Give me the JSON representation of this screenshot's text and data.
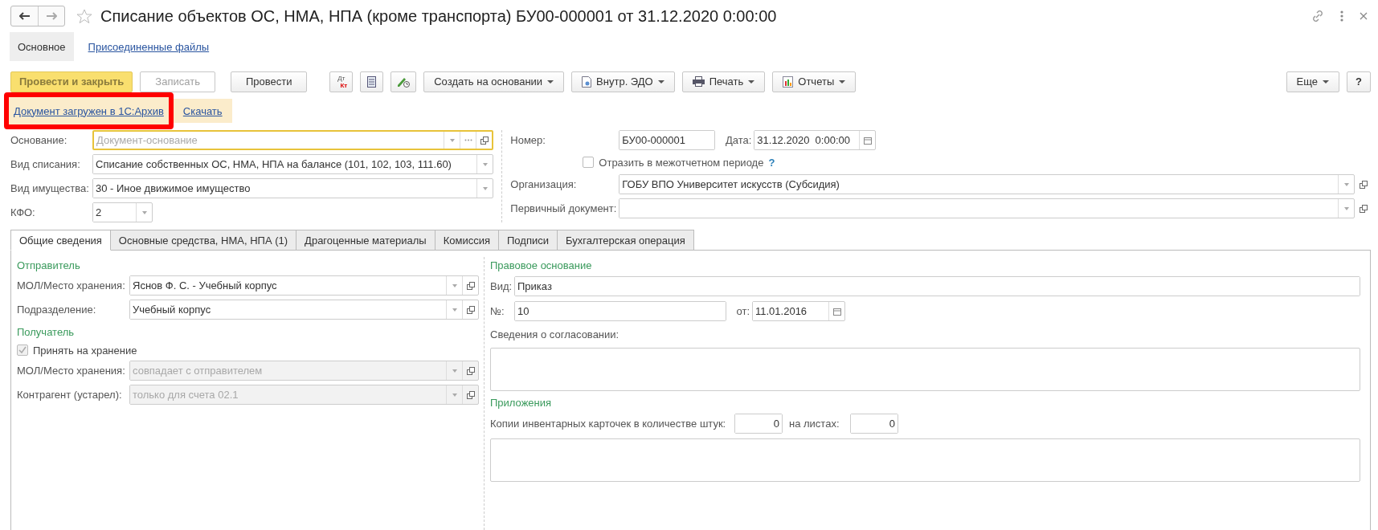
{
  "window": {
    "title": "Списание объектов ОС, НМА, НПА (кроме транспорта) БУ00-000001 от 31.12.2020 0:00:00"
  },
  "nav_buttons": [
    {
      "kind": "back",
      "disabled": false
    },
    {
      "kind": "forward",
      "disabled": true
    }
  ],
  "sections": [
    {
      "label": "Основное",
      "selected": true
    },
    {
      "label": "Присоединенные файлы",
      "selected": false
    }
  ],
  "toolbar": [
    {
      "kind": "text",
      "label": "Провести и закрыть",
      "primary": true,
      "disabled": false
    },
    {
      "kind": "text",
      "label": "Записать",
      "primary": false,
      "disabled": true
    },
    {
      "kind": "text",
      "label": "Провести",
      "primary": false,
      "disabled": false
    },
    {
      "kind": "dtkt",
      "top": "Дт",
      "bottom": "Кт"
    },
    {
      "kind": "list"
    },
    {
      "kind": "signature"
    },
    {
      "kind": "dropdown",
      "label": "Создать на основании"
    },
    {
      "kind": "dropdown-doc",
      "label": "Внутр. ЭДО"
    },
    {
      "kind": "dropdown-print",
      "label": "Печать"
    },
    {
      "kind": "dropdown-chart",
      "label": "Отчеты"
    }
  ],
  "toolbar_right": [
    {
      "kind": "dropdown",
      "label": "Еще"
    },
    {
      "kind": "help",
      "label": "?"
    }
  ],
  "archive_bar": {
    "status_link": "Документ загружен в 1С:Архив",
    "highlighted": true,
    "download_link": "Скачать"
  },
  "header_left": [
    {
      "label": "Основание:",
      "placeholder": "Документ-основание",
      "kind": "reference",
      "focused": true
    },
    {
      "label": "Вид списания:",
      "value": "Списание собственных ОС, НМА, НПА на балансе (101, 102, 103, 111.60)",
      "kind": "select",
      "focused": false
    },
    {
      "label": "Вид имущества:",
      "value": "30 - Иное движимое имущество",
      "kind": "select",
      "focused": false
    },
    {
      "label": "КФО:",
      "value": "2",
      "kind": "short-select",
      "focused": false
    }
  ],
  "header_right": {
    "number_label": "Номер:",
    "number": "БУ00-000001",
    "date_label": "Дата:",
    "date": "31.12.2020  0:00:00",
    "interperiod": {
      "label": "Отразить в межотчетном периоде",
      "checked": false,
      "help": "?"
    },
    "fields": [
      {
        "label": "Организация:",
        "value": "ГОБУ ВПО Университет искусств (Субсидия)"
      },
      {
        "label": "Первичный документ:"
      }
    ]
  },
  "tabs": [
    {
      "label": "Общие сведения",
      "selected": true
    },
    {
      "label": "Основные средства, НМА, НПА (1)",
      "selected": false
    },
    {
      "label": "Драгоценные материалы",
      "selected": false
    },
    {
      "label": "Комиссия",
      "selected": false
    },
    {
      "label": "Подписи",
      "selected": false
    },
    {
      "label": "Бухгалтерская операция",
      "selected": false
    }
  ],
  "sender": {
    "title": "Отправитель",
    "fields": [
      {
        "label": "МОЛ/Место хранения:",
        "value": "Яснов Ф. С. - Учебный корпус",
        "disabled": false
      },
      {
        "label": "Подразделение:",
        "value": "Учебный корпус",
        "disabled": false
      }
    ]
  },
  "receiver": {
    "title": "Получатель",
    "accept": {
      "label": "Принять на хранение",
      "checked": true,
      "disabled": true
    },
    "fields": [
      {
        "label": "МОЛ/Место хранения:",
        "placeholder": "совпадает с отправителем",
        "disabled": true
      },
      {
        "label": "Контрагент (устарел):",
        "placeholder": "только для счета 02.1",
        "disabled": true
      }
    ]
  },
  "legal_basis": {
    "title": "Правовое основание",
    "kind_label": "Вид:",
    "kind_value": "Приказ",
    "number_label": "№:",
    "number": "10",
    "date_label": "от:",
    "date": "11.01.2016",
    "approval_label": "Сведения о согласовании:"
  },
  "attachments": {
    "title": "Приложения",
    "copies_label": "Копии инвентарных карточек в количестве штук:",
    "copies": "0",
    "sheets_label": "на листах:",
    "sheets": "0"
  }
}
